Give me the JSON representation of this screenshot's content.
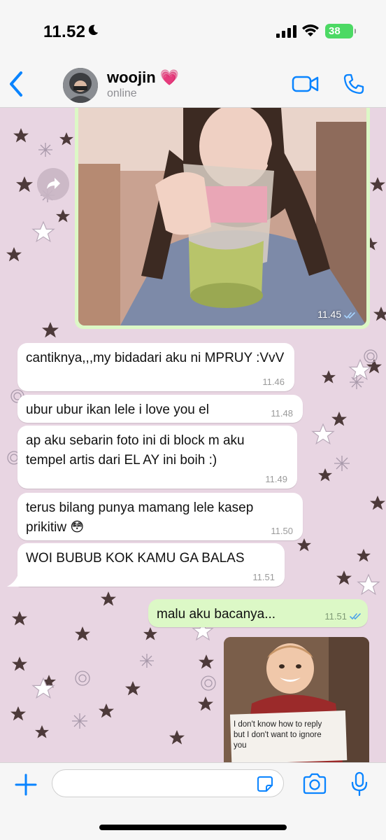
{
  "status_bar": {
    "time": "11.52",
    "battery": "38",
    "moon_icon": "moon-icon",
    "signal_icon": "cellular-signal-icon",
    "wifi_icon": "wifi-icon"
  },
  "header": {
    "contact_name": "woojin",
    "contact_emoji": "💗",
    "status": "online",
    "icons": [
      "back-chevron-icon",
      "video-call-icon",
      "phone-icon"
    ]
  },
  "messages": {
    "photo": {
      "time": "11.45",
      "read_icon": "double-check-icon"
    },
    "incoming": [
      {
        "text": "cantiknya,,,my bidadari aku ni MPRUY :VvV",
        "time": "11.46"
      },
      {
        "text": "ubur ubur ikan lele i love you el",
        "time": "11.48"
      },
      {
        "text": "ap aku sebarin foto ini di block m aku tempel artis dari EL AY ini boih :)",
        "time": "11.49"
      },
      {
        "text": "terus bilang punya mamang lele kasep prikitiw 😳",
        "time": "11.50"
      },
      {
        "text": "WOI BUBUB KOK KAMU GA BALAS",
        "time": "11.51"
      }
    ],
    "outgoing": {
      "text": "malu aku bacanya...",
      "time": "11.51"
    },
    "meme": {
      "caption": "I don't know how to reply but I don't want to ignore you"
    }
  },
  "input_bar": {
    "placeholder": "",
    "icons": [
      "plus-icon",
      "sticker-icon",
      "camera-icon",
      "microphone-icon"
    ]
  },
  "colors": {
    "accent": "#0a84ff",
    "outgoing_bubble": "#dcf8c6",
    "incoming_bubble": "#ffffff",
    "wallpaper": "#e8d5e2",
    "battery": "#4cd964"
  }
}
